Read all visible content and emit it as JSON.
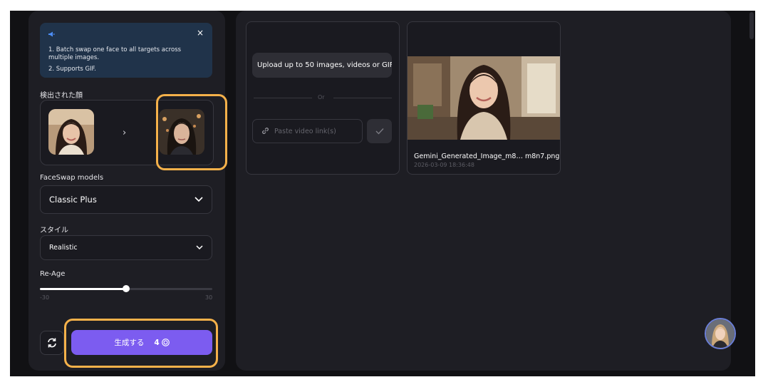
{
  "info": {
    "items": [
      "1. Batch swap one face to all targets across multiple images.",
      "2. Supports GIF."
    ],
    "close_label": "×"
  },
  "faces": {
    "label": "検出された顔",
    "arrow": "›"
  },
  "model": {
    "label": "FaceSwap models",
    "value": "Classic Plus"
  },
  "style": {
    "label": "スタイル",
    "value": "Realistic"
  },
  "reage": {
    "label": "Re-Age",
    "min": "-30",
    "max": "30",
    "value_fraction": 0.5
  },
  "generate": {
    "label": "生成する",
    "credits": "4"
  },
  "upload": {
    "button_label": "Upload up to 50 images, videos or GIFs",
    "or_label": "Or",
    "link_placeholder": "Paste video link(s)"
  },
  "image_card": {
    "name": "Gemini_Generated_Image_m8… m8n7.png",
    "date": "2026-03-09 18:36:48"
  },
  "colors": {
    "accent": "#7c5cf0",
    "highlight": "#f5b14a",
    "info_bg": "#20334a"
  }
}
